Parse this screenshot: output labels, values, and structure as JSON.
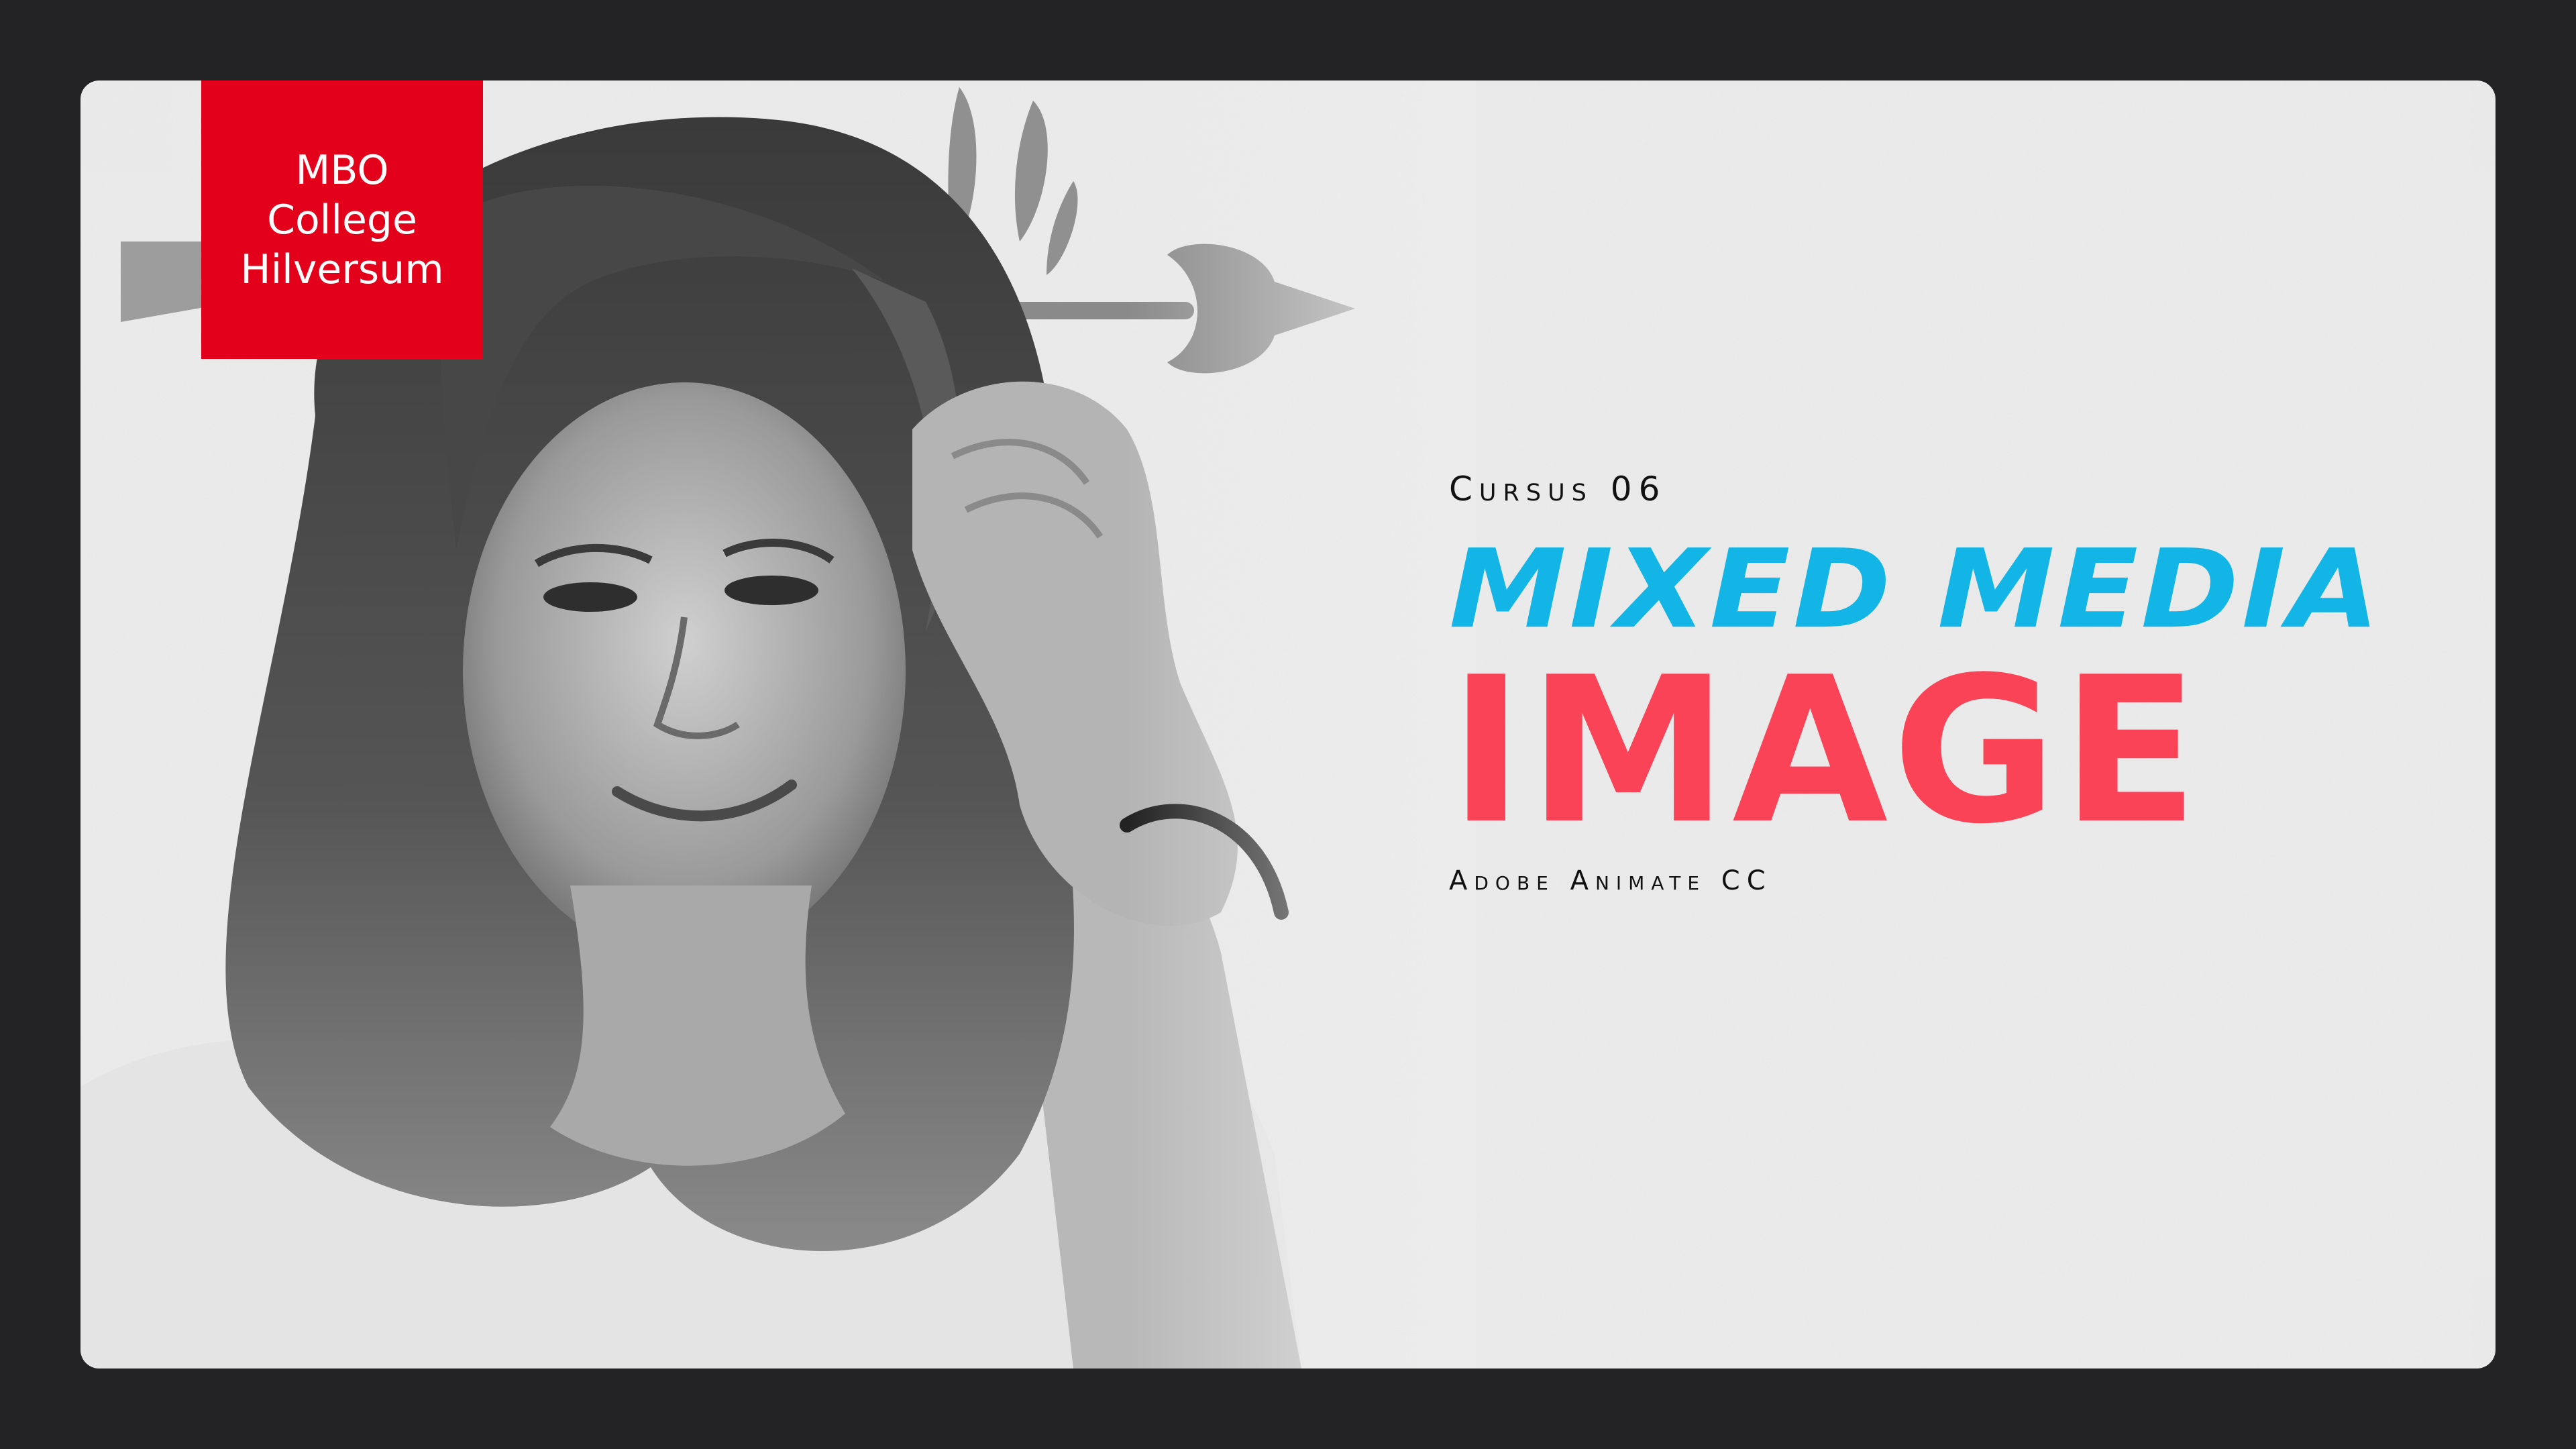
{
  "logo": {
    "line1": "MBO",
    "line2": "College",
    "line3": "Hilversum",
    "color": "#e2001a"
  },
  "course": {
    "label": "Cursus 06"
  },
  "title": {
    "line1": "MIXED MEDIA",
    "line2": "IMAGE",
    "line1_color": "#12b5e5",
    "line2_color": "#fa4357"
  },
  "subtitle": "Adobe Animate CC",
  "icons": {
    "arrow": "heart-arrow-icon",
    "leaves": "leaf-sprig-icon"
  }
}
